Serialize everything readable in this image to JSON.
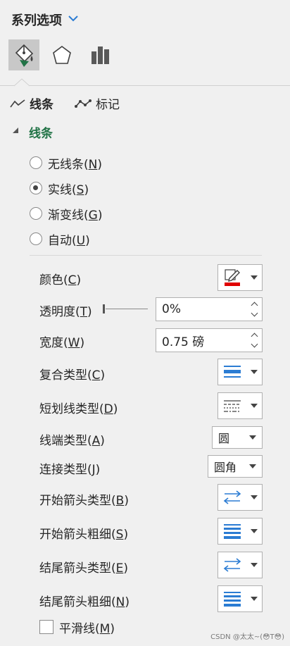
{
  "header": {
    "title": "系列选项"
  },
  "category_tabs": [
    {
      "name": "fill-line",
      "icon": "paint-bucket-icon",
      "active": true
    },
    {
      "name": "effects",
      "icon": "pentagon-icon",
      "active": false
    },
    {
      "name": "series-options",
      "icon": "bar-chart-icon",
      "active": false
    }
  ],
  "sub_tabs": {
    "line": "线条",
    "marker": "标记"
  },
  "section": {
    "title": "线条"
  },
  "radios": [
    {
      "pre": "无线条(",
      "key": "N",
      "post": ")",
      "checked": false
    },
    {
      "pre": "实线(",
      "key": "S",
      "post": ")",
      "checked": true
    },
    {
      "pre": "渐变线(",
      "key": "G",
      "post": ")",
      "checked": false
    },
    {
      "pre": "自动(",
      "key": "U",
      "post": ")",
      "checked": false
    }
  ],
  "props": {
    "color": {
      "pre": "颜色(",
      "key": "C",
      "post": ")"
    },
    "transparency": {
      "pre": "透明度(",
      "key": "T",
      "post": ")",
      "value": "0%"
    },
    "width": {
      "pre": "宽度(",
      "key": "W",
      "post": ")",
      "value": "0.75 磅"
    },
    "compound": {
      "pre": "复合类型(",
      "key": "C",
      "post": ")"
    },
    "dash": {
      "pre": "短划线类型(",
      "key": "D",
      "post": ")"
    },
    "cap": {
      "pre": "线端类型(",
      "key": "A",
      "post": ")",
      "value": "圆"
    },
    "join": {
      "pre": "连接类型(",
      "key": "J",
      "post": ")",
      "value": "圆角"
    },
    "begin_type": {
      "pre": "开始箭头类型(",
      "key": "B",
      "post": ")"
    },
    "begin_size": {
      "pre": "开始箭头粗细(",
      "key": "S",
      "post": ")"
    },
    "end_type": {
      "pre": "结尾箭头类型(",
      "key": "E",
      "post": ")"
    },
    "end_size": {
      "pre": "结尾箭头粗细(",
      "key": "N",
      "post": ")"
    }
  },
  "smooth": {
    "pre": "平滑线(",
    "key": "M",
    "post": ")",
    "checked": false
  },
  "colors": {
    "accent_green": "#217346",
    "icon_blue": "#2b7cd3",
    "line_red": "#e00000"
  },
  "watermark": "CSDN @太太~(😳T😳)"
}
